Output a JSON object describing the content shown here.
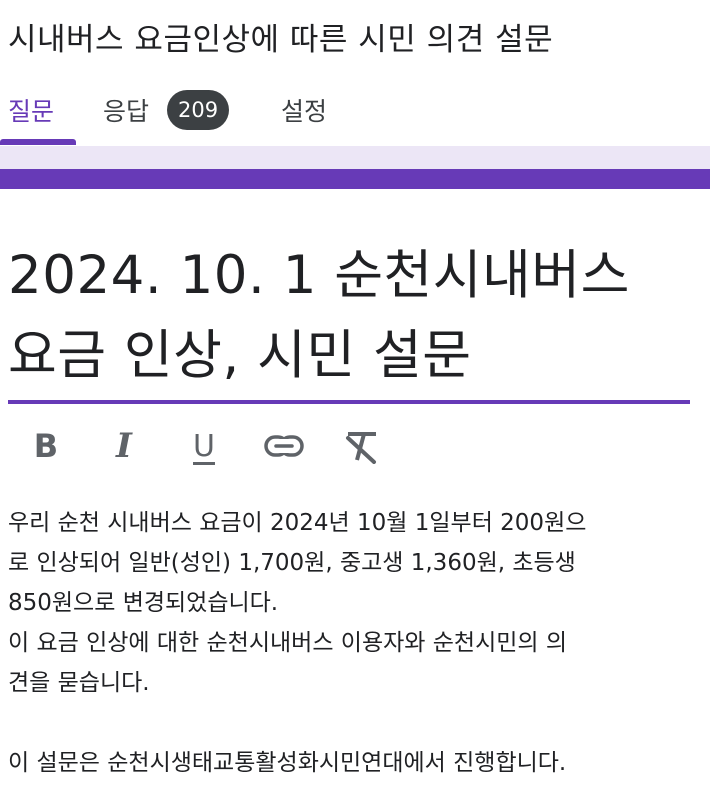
{
  "header": {
    "title": "시내버스 요금인상에 따른 시민 의견 설문"
  },
  "tabs": {
    "questions": "질문",
    "responses": "응답",
    "responses_count": "209",
    "settings": "설정"
  },
  "form": {
    "title_line1": "2024. 10. 1 순천시내버스",
    "title_line2": "요금 인상, 시민 설문",
    "description_lines": [
      "우리 순천 시내버스 요금이 2024년 10월 1일부터 200원으",
      "로 인상되어 일반(성인) 1,700원, 중고생 1,360원, 초등생",
      "850원으로 변경되었습니다.",
      "이 요금 인상에 대한 순천시내버스 이용자와 순천시민의 의",
      "견을 묻습니다.",
      "",
      "이 설문은 순천시생태교통활성화시민연대에서 진행합니다."
    ]
  },
  "toolbar": {
    "bold_icon": "bold-icon",
    "italic_icon": "italic-icon",
    "underline_icon": "underline-icon",
    "link_icon": "link-icon",
    "clear_format_icon": "clear-format-icon"
  },
  "colors": {
    "accent": "#673ab7",
    "accent_light": "#ece6f6",
    "badge": "#3c4043",
    "text": "#202124",
    "icon": "#5f6368"
  }
}
